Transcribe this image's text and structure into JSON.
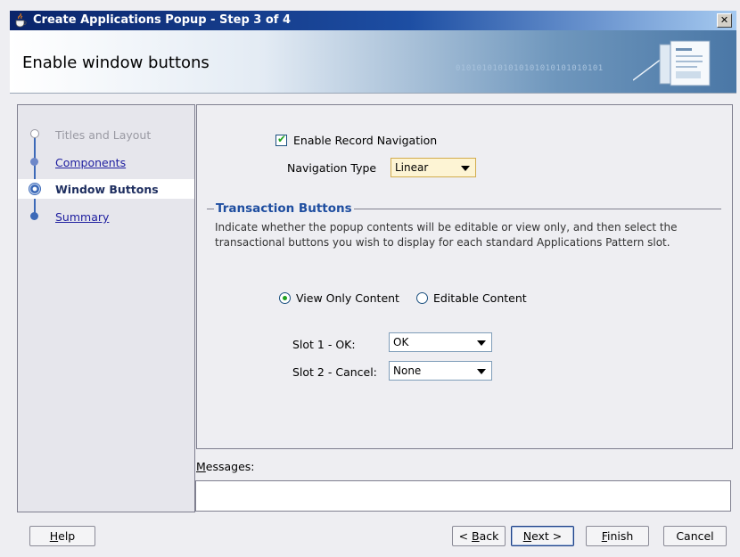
{
  "window": {
    "title": "Create Applications Popup - Step 3 of 4",
    "close_icon": "close-icon"
  },
  "banner": {
    "step_title": "Enable window buttons",
    "binary_text": "0101010101010101010101010101"
  },
  "nav": {
    "items": [
      {
        "label": "Titles and Layout",
        "state": "disabled"
      },
      {
        "label": "Components",
        "state": "link"
      },
      {
        "label": "Window Buttons",
        "state": "current"
      },
      {
        "label": "Summary",
        "state": "link"
      }
    ]
  },
  "record_nav": {
    "checkbox_label": "Enable Record Navigation",
    "checked": true,
    "nav_type_label": "Navigation Type",
    "nav_type_value": "Linear"
  },
  "transaction": {
    "section_title": "Transaction Buttons",
    "description": "Indicate whether the popup contents will be editable or view only, and then select the transactional buttons you wish to display for each standard Applications Pattern slot.",
    "radio_view_only": "View Only Content",
    "radio_editable": "Editable Content",
    "selected": "View Only Content",
    "slot1_label": "Slot 1 - OK:",
    "slot1_value": "OK",
    "slot2_label": "Slot 2 - Cancel:",
    "slot2_value": "None"
  },
  "messages": {
    "label": "Messages:",
    "mnemonic": "M",
    "rest": "essages:"
  },
  "buttons": {
    "help": {
      "mn": "H",
      "rest": "elp"
    },
    "back": {
      "pre": "< ",
      "mn": "B",
      "rest": "ack"
    },
    "next": {
      "mn": "N",
      "rest": "ext >"
    },
    "finish": {
      "mn": "F",
      "rest": "inish"
    },
    "cancel": "Cancel"
  },
  "colors": {
    "titlebar": "#0a246a",
    "accent_blue": "#1f4ea0",
    "check_green": "#21a121",
    "link": "#2020a0"
  }
}
